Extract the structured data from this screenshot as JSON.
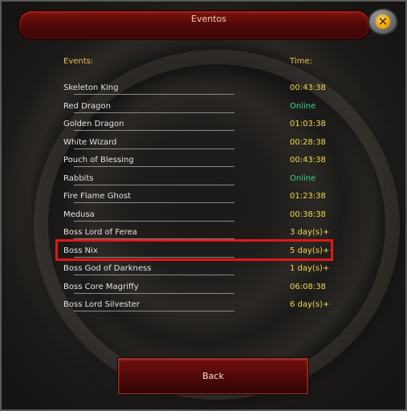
{
  "window": {
    "title": "Eventos"
  },
  "header": {
    "events_label": "Events:",
    "time_label": "Time:"
  },
  "events": [
    {
      "name": "Skeleton King",
      "time": "00:43:38",
      "status": "timer"
    },
    {
      "name": "Red Dragon",
      "time": "Online",
      "status": "online"
    },
    {
      "name": "Golden Dragon",
      "time": "01:03:38",
      "status": "timer"
    },
    {
      "name": "White Wizard",
      "time": "00:28:38",
      "status": "timer"
    },
    {
      "name": "Pouch of Blessing",
      "time": "00:43:38",
      "status": "timer"
    },
    {
      "name": "Rabbits",
      "time": "Online",
      "status": "online"
    },
    {
      "name": "Fire Flame Ghost",
      "time": "01:23:38",
      "status": "timer"
    },
    {
      "name": "Medusa",
      "time": "00:38:38",
      "status": "timer"
    },
    {
      "name": "Boss Lord of Ferea",
      "time": "3 day(s)+",
      "status": "timer"
    },
    {
      "name": "Boss Nix",
      "time": "5 day(s)+",
      "status": "timer",
      "highlighted": true
    },
    {
      "name": "Boss God of Darkness",
      "time": "1 day(s)+",
      "status": "timer"
    },
    {
      "name": "Boss Core Magriffy",
      "time": "06:08:38",
      "status": "timer"
    },
    {
      "name": "Boss Lord Silvester",
      "time": "6 day(s)+",
      "status": "timer"
    }
  ],
  "footer": {
    "back_label": "Back"
  },
  "colors": {
    "timer": "#efd94a",
    "online": "#35d88a",
    "highlight": "#e01818",
    "title_bar": "#7d1010"
  },
  "icons": {
    "close": "close-icon"
  }
}
